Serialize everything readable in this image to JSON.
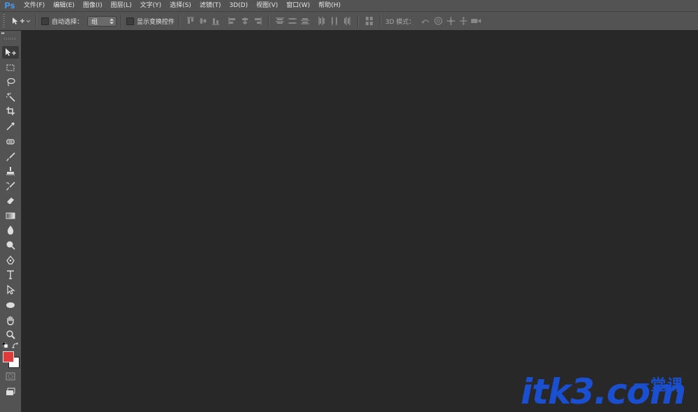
{
  "app": {
    "logo": "Ps"
  },
  "menu": [
    "文件(F)",
    "编辑(E)",
    "图像(I)",
    "图层(L)",
    "文字(Y)",
    "选择(S)",
    "滤镜(T)",
    "3D(D)",
    "视图(V)",
    "窗口(W)",
    "帮助(H)"
  ],
  "options": {
    "auto_select_label": "自动选择：",
    "auto_select_value": "组",
    "show_transform_label": "显示变换控件",
    "mode_3d_label": "3D 模式："
  },
  "colors": {
    "foreground": "#e03a3a",
    "background": "#ffffff",
    "ui_panel": "#535353",
    "canvas": "#282828"
  },
  "watermark": {
    "text": "itk3.com",
    "cn": "一堂课"
  },
  "tools": [
    "move-tool-icon",
    "marquee-tool-icon",
    "lasso-tool-icon",
    "magic-wand-tool-icon",
    "crop-tool-icon",
    "eyedropper-tool-icon",
    "healing-brush-tool-icon",
    "brush-tool-icon",
    "clone-stamp-tool-icon",
    "history-brush-tool-icon",
    "eraser-tool-icon",
    "gradient-tool-icon",
    "blur-tool-icon",
    "dodge-tool-icon",
    "pen-tool-icon",
    "type-tool-icon",
    "path-selection-tool-icon",
    "ellipse-tool-icon",
    "hand-tool-icon",
    "zoom-tool-icon"
  ]
}
